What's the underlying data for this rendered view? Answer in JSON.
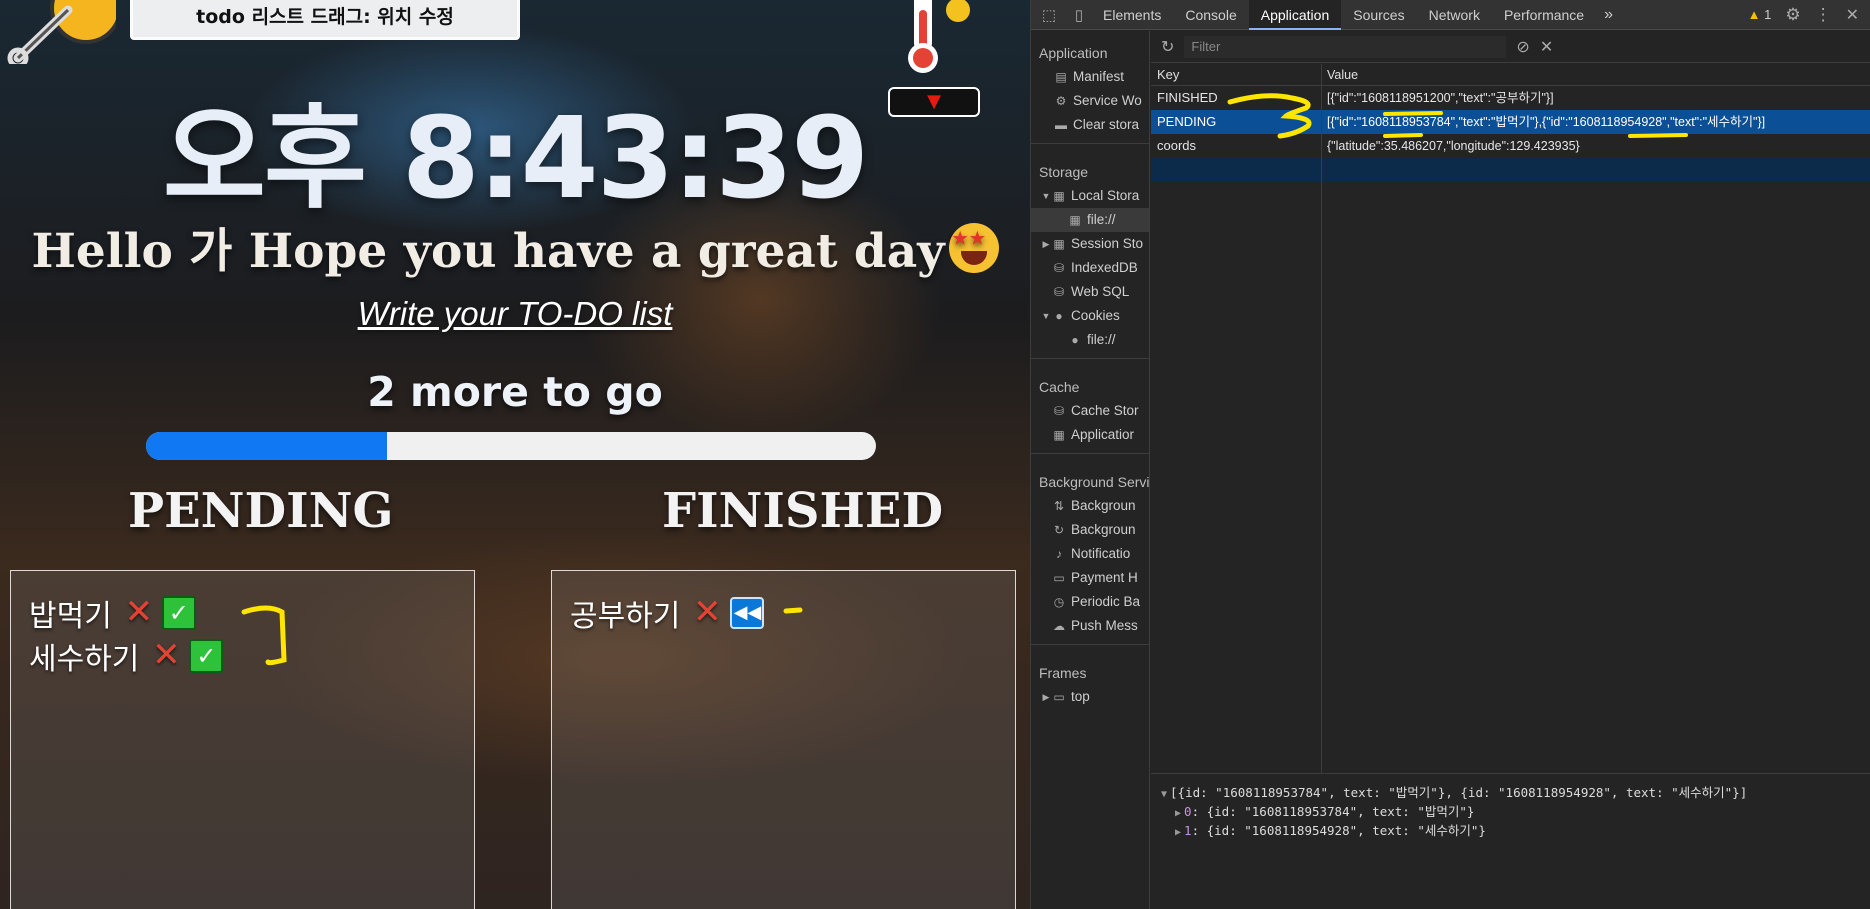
{
  "app": {
    "banner_title": "todo 리스트 드래그: 위치 수정",
    "weather_toggle": "▼",
    "clock": "오후 8:43:39",
    "greeting": "Hello 가 Hope you have a great day",
    "write_link": "Write your TO-DO list",
    "remaining": "2 more to go",
    "progress_fraction": 0.33,
    "pending_heading": "PENDING",
    "finished_heading": "FINISHED",
    "pending_items": [
      {
        "text": "밥먹기",
        "delete": "✕",
        "done": "✓"
      },
      {
        "text": "세수하기",
        "delete": "✕",
        "done": "✓"
      }
    ],
    "finished_items": [
      {
        "text": "공부하기",
        "delete": "✕",
        "restore": "◀◀"
      }
    ]
  },
  "devtools": {
    "tabs": [
      "Elements",
      "Console",
      "Application",
      "Sources",
      "Network",
      "Performance"
    ],
    "active_tab": "Application",
    "more_tabs": "»",
    "warning_count": "1",
    "sidebar": {
      "application_heading": "Application",
      "application_items": [
        "Manifest",
        "Service Wo",
        "Clear stora"
      ],
      "storage_heading": "Storage",
      "local_storage": "Local Stora",
      "local_storage_child": "file://",
      "session_storage": "Session Sto",
      "indexeddb": "IndexedDB",
      "websql": "Web SQL",
      "cookies": "Cookies",
      "cookies_child": "file://",
      "cache_heading": "Cache",
      "cache_items": [
        "Cache Stor",
        "Applicatior"
      ],
      "background_heading": "Background Servi",
      "background_items": [
        "Backgroun",
        "Backgroun",
        "Notificatio",
        "Payment H",
        "Periodic Ba",
        "Push Mess"
      ],
      "frames_heading": "Frames",
      "frames_top": "top"
    },
    "filter_placeholder": "Filter",
    "table": {
      "key_header": "Key",
      "value_header": "Value",
      "rows": [
        {
          "key": "FINISHED",
          "value": "[{\"id\":\"1608118951200\",\"text\":\"공부하기\"}]"
        },
        {
          "key": "PENDING",
          "value": "[{\"id\":\"1608118953784\",\"text\":\"밥먹기\"},{\"id\":\"1608118954928\",\"text\":\"세수하기\"}]"
        },
        {
          "key": "coords",
          "value": "{\"latitude\":35.486207,\"longitude\":129.423935}"
        }
      ]
    },
    "console": {
      "summary": "[{id: \"1608118953784\", text: \"밥먹기\"}, {id: \"1608118954928\", text: \"세수하기\"}]",
      "entries": [
        {
          "index": "0",
          "value": "{id: \"1608118953784\", text: \"밥먹기\"}"
        },
        {
          "index": "1",
          "value": "{id: \"1608118954928\", text: \"세수하기\"}"
        }
      ]
    }
  }
}
